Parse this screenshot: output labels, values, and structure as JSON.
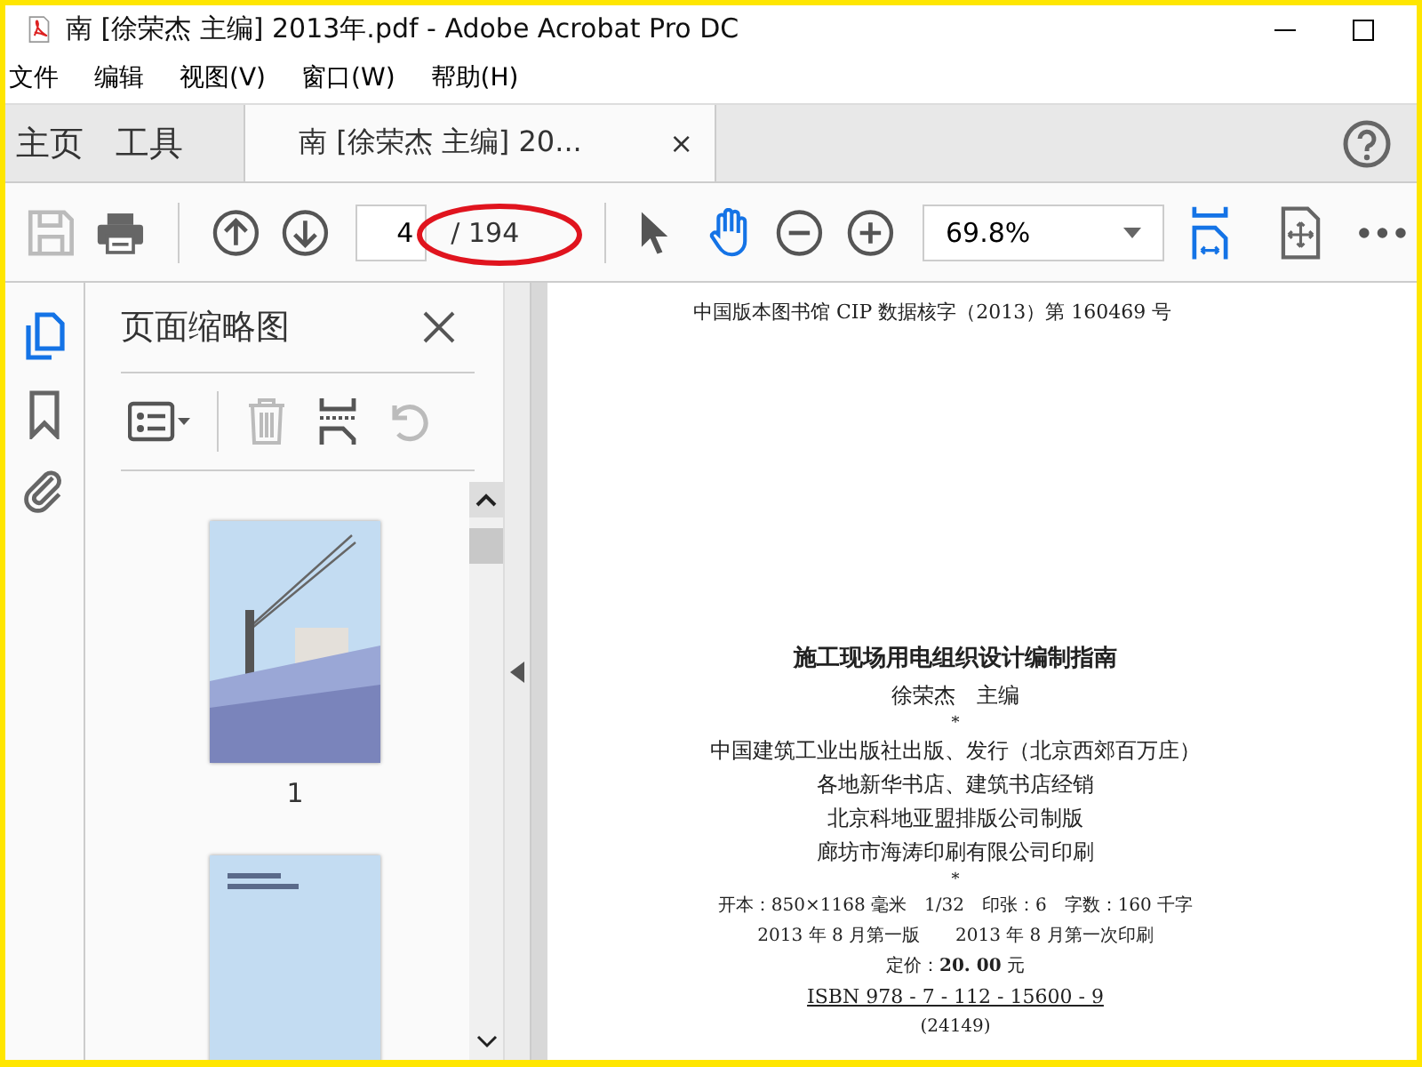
{
  "window": {
    "title": "南 [徐荣杰 主编] 2013年.pdf - Adobe Acrobat Pro DC"
  },
  "menu": [
    "文件",
    "编辑",
    "视图(V)",
    "窗口(W)",
    "帮助(H)"
  ],
  "tabs": [
    {
      "label": "主页",
      "kind": "nav",
      "selected": false
    },
    {
      "label": "工具",
      "kind": "nav",
      "selected": false
    },
    {
      "label": "南 [徐荣杰 主编] 20...",
      "kind": "document",
      "selected": true,
      "close": "×"
    }
  ],
  "toolbar": {
    "page_number": "4",
    "page_total": "/ 194",
    "zoom": "69.8%",
    "hand_tool_selected": true
  },
  "side_rail": [
    {
      "kind": "pages",
      "selected": true
    },
    {
      "kind": "bookmarks",
      "selected": false
    },
    {
      "kind": "attachments",
      "selected": false
    }
  ],
  "thumbnail_panel": {
    "title": "页面缩略图",
    "thumbnails": [
      {
        "kind": "picture",
        "label": "1"
      },
      {
        "kind": "picture"
      }
    ]
  },
  "document": {
    "lines": [
      {
        "kind": "cip",
        "text": "中国版本图书馆 CIP 数据核字（2013）第 160469 号"
      },
      {
        "kind": "title",
        "text": "施工现场用电组织设计编制指南"
      },
      {
        "kind": "normal",
        "text": "徐荣杰　主编"
      },
      {
        "kind": "mark",
        "text": "*"
      },
      {
        "kind": "normal",
        "text": "中国建筑工业出版社出版、发行（北京西郊百万庄）"
      },
      {
        "kind": "normal",
        "text": "各地新华书店、建筑书店经销"
      },
      {
        "kind": "normal",
        "text": "北京科地亚盟排版公司制版"
      },
      {
        "kind": "normal",
        "text": "廊坊市海涛印刷有限公司印刷"
      },
      {
        "kind": "mark",
        "text": "*"
      },
      {
        "kind": "small",
        "text": "开本：850×1168 毫米　1/32　印张：6　字数：160 千字"
      },
      {
        "kind": "small",
        "text": "2013 年 8 月第一版　　2013 年 8 月第一次印刷"
      },
      {
        "kind": "small",
        "text": "定价：**20. 00** 元"
      },
      {
        "kind": "isbn",
        "text": "ISBN 978 - 7 - 112 - 15600 - 9"
      },
      {
        "kind": "small",
        "text": "(24149)"
      }
    ]
  }
}
